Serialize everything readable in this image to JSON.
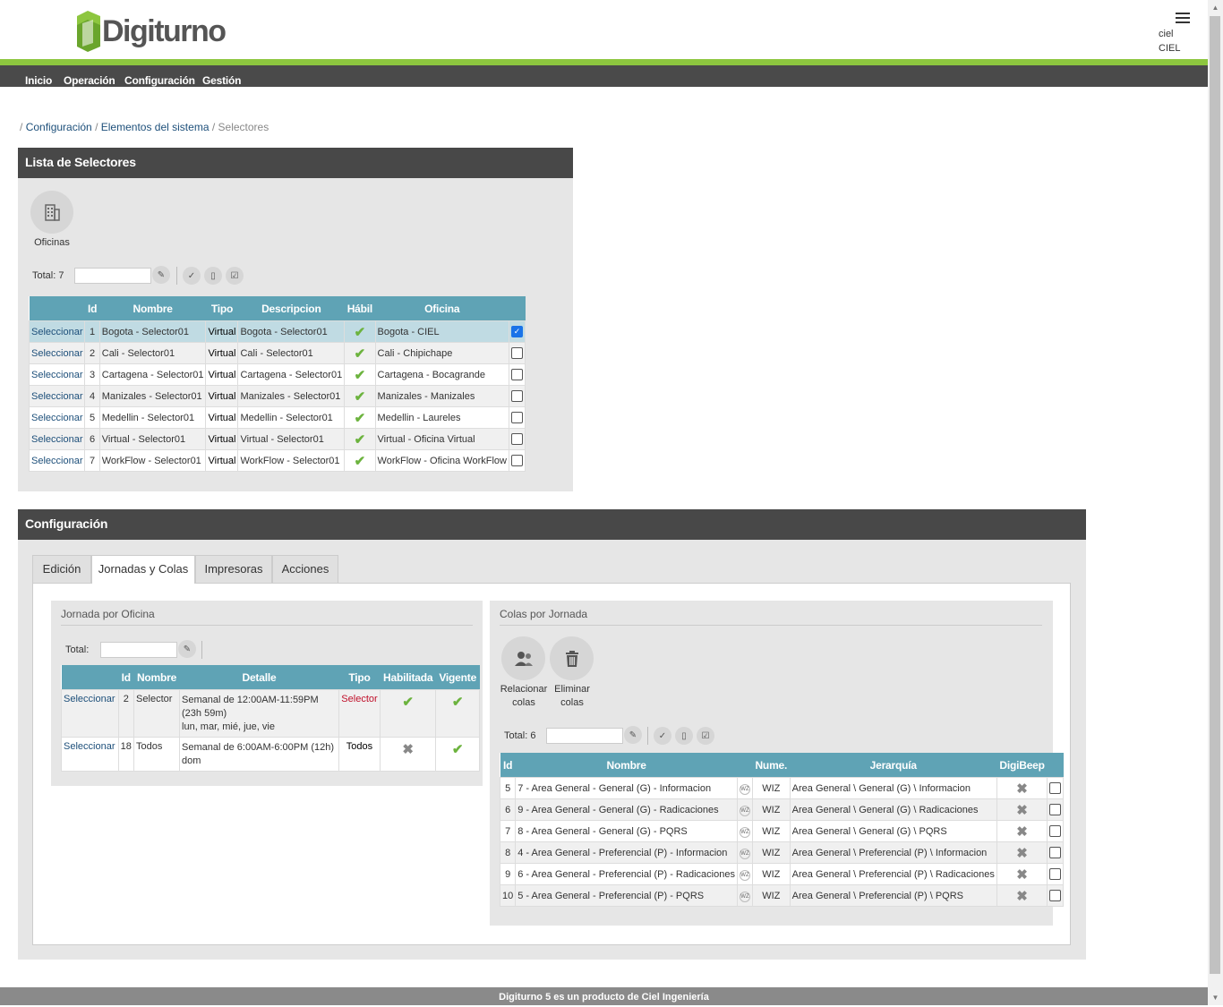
{
  "brand": {
    "name": "Digiturno"
  },
  "user": {
    "line1": "ciel",
    "line2": "CIEL"
  },
  "nav": {
    "items": [
      "Inicio",
      "Operación",
      "Configuración",
      "Gestión"
    ]
  },
  "breadcrumb": {
    "sep": "/",
    "items": [
      "Configuración",
      "Elementos del sistema",
      "Selectores"
    ]
  },
  "list_panel": {
    "title": "Lista de Selectores",
    "offices_label": "Oficinas",
    "total_label": "Total:",
    "total": "7",
    "columns": [
      "Id",
      "Nombre",
      "Tipo",
      "Descripcion",
      "Hábil",
      "Oficina"
    ],
    "select_label": "Seleccionar",
    "rows": [
      {
        "id": "1",
        "nombre": "Bogota - Selector01",
        "tipo": "Virtual",
        "descripcion": "Bogota - Selector01",
        "oficina": "Bogota - CIEL",
        "checked": true
      },
      {
        "id": "2",
        "nombre": "Cali - Selector01",
        "tipo": "Virtual",
        "descripcion": "Cali - Selector01",
        "oficina": "Cali - Chipichape",
        "checked": false
      },
      {
        "id": "3",
        "nombre": "Cartagena - Selector01",
        "tipo": "Virtual",
        "descripcion": "Cartagena - Selector01",
        "oficina": "Cartagena - Bocagrande",
        "checked": false
      },
      {
        "id": "4",
        "nombre": "Manizales - Selector01",
        "tipo": "Virtual",
        "descripcion": "Manizales - Selector01",
        "oficina": "Manizales - Manizales",
        "checked": false
      },
      {
        "id": "5",
        "nombre": "Medellin - Selector01",
        "tipo": "Virtual",
        "descripcion": "Medellin - Selector01",
        "oficina": "Medellin - Laureles",
        "checked": false
      },
      {
        "id": "6",
        "nombre": "Virtual - Selector01",
        "tipo": "Virtual",
        "descripcion": "Virtual - Selector01",
        "oficina": "Virtual - Oficina Virtual",
        "checked": false
      },
      {
        "id": "7",
        "nombre": "WorkFlow - Selector01",
        "tipo": "Virtual",
        "descripcion": "WorkFlow - Selector01",
        "oficina": "WorkFlow - Oficina WorkFlow",
        "checked": false
      }
    ]
  },
  "config_panel": {
    "title": "Configuración",
    "tabs": [
      "Edición",
      "Jornadas y Colas",
      "Impresoras",
      "Acciones"
    ],
    "active_tab": "Jornadas y Colas",
    "jornada": {
      "title": "Jornada por Oficina",
      "total_label": "Total:",
      "columns": [
        "Id",
        "Nombre",
        "Detalle",
        "Tipo",
        "Habilitada",
        "Vigente"
      ],
      "rows": [
        {
          "id": "2",
          "nombre": "Selector",
          "detalle1": "Semanal de 12:00AM-11:59PM",
          "detalle2": "(23h 59m)",
          "detalle3": "lun, mar, mié, jue, vie",
          "tipo": "Selector",
          "habilitada": true,
          "vigente": true
        },
        {
          "id": "18",
          "nombre": "Todos",
          "detalle1": "Semanal de 6:00AM-6:00PM (12h)",
          "detalle2": "dom",
          "detalle3": "",
          "tipo": "Todos",
          "habilitada": false,
          "vigente": true
        }
      ]
    },
    "colas": {
      "title": "Colas por Jornada",
      "relate_label_1": "Relacionar",
      "relate_label_2": "colas",
      "delete_label_1": "Eliminar",
      "delete_label_2": "colas",
      "total_label": "Total:",
      "total": "6",
      "columns": [
        "Id",
        "Nombre",
        "Nume.",
        "Jerarquía",
        "DigiBeep"
      ],
      "wz_icon_text": "WZ",
      "rows": [
        {
          "id": "5",
          "nombre": "7 - Area General - General (G) - Informacion",
          "nume": "WIZ",
          "jerarquia": "Area General \\ General (G) \\ Informacion"
        },
        {
          "id": "6",
          "nombre": "9 - Area General - General (G) - Radicaciones",
          "nume": "WIZ",
          "jerarquia": "Area General \\ General (G) \\ Radicaciones"
        },
        {
          "id": "7",
          "nombre": "8 - Area General - General (G) - PQRS",
          "nume": "WIZ",
          "jerarquia": "Area General \\ General (G) \\ PQRS"
        },
        {
          "id": "8",
          "nombre": "4 - Area General - Preferencial (P) - Informacion",
          "nume": "WIZ",
          "jerarquia": "Area General \\ Preferencial (P) \\ Informacion"
        },
        {
          "id": "9",
          "nombre": "6 - Area General - Preferencial (P) - Radicaciones",
          "nume": "WIZ",
          "jerarquia": "Area General \\ Preferencial (P) \\ Radicaciones"
        },
        {
          "id": "10",
          "nombre": "5 - Area General - Preferencial (P) - PQRS",
          "nume": "WIZ",
          "jerarquia": "Area General \\ Preferencial (P) \\ PQRS"
        }
      ]
    }
  },
  "footer": {
    "text": "Digiturno 5 es un producto de Ciel Ingeniería"
  },
  "colors": {
    "accent_green": "#8dc63f",
    "header_dark": "#484848",
    "table_header": "#5fa3b5",
    "ok_green": "#6cb33e"
  }
}
